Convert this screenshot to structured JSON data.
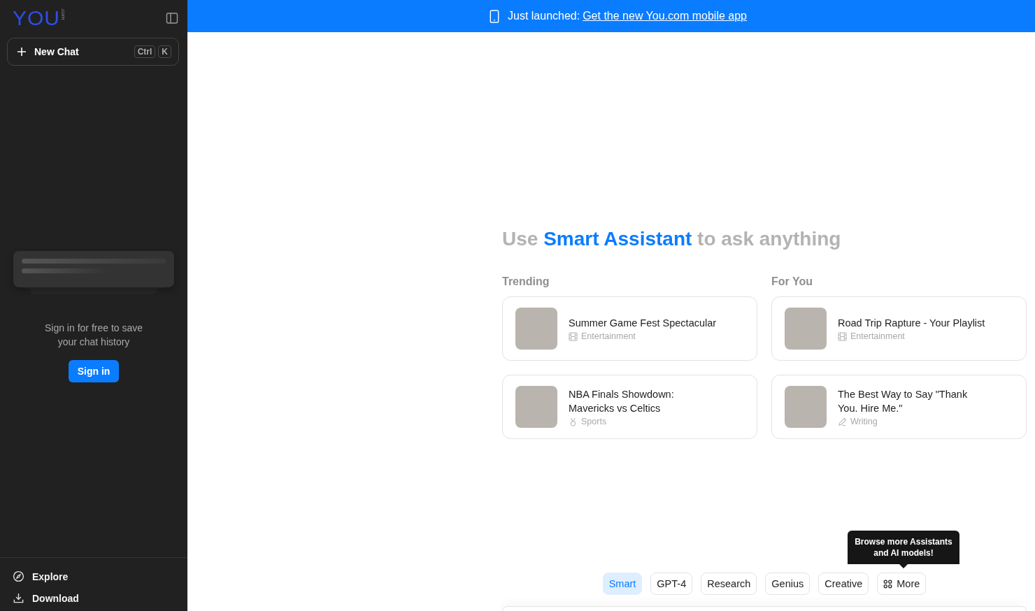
{
  "sidebar": {
    "logo": "YOU",
    "logo_suffix": ".com",
    "new_chat": {
      "label": "New Chat",
      "keys": [
        "Ctrl",
        "K"
      ]
    },
    "sign_in_prompt": "Sign in for free to save your chat history",
    "sign_in_button": "Sign in",
    "nav": [
      {
        "kind": "explore",
        "label": "Explore"
      },
      {
        "kind": "download",
        "label": "Download"
      }
    ]
  },
  "banner": {
    "text": "Just launched:",
    "link": "Get the new You.com mobile app"
  },
  "headline": {
    "prefix": "Use",
    "highlight": "Smart Assistant",
    "suffix": "to ask anything"
  },
  "sections": [
    {
      "title": "Trending",
      "cards": [
        {
          "title": "Summer Game Fest Spectacular",
          "category": "Entertainment",
          "kind": "film"
        },
        {
          "title": "NBA Finals Showdown: Mavericks vs Celtics",
          "category": "Sports",
          "kind": "medal"
        }
      ]
    },
    {
      "title": "For You",
      "cards": [
        {
          "title": "Road Trip Rapture - Your Playlist",
          "category": "Entertainment",
          "kind": "film"
        },
        {
          "title": "The Best Way to Say \"Thank You. Hire Me.\"",
          "category": "Writing",
          "kind": "pen"
        }
      ]
    }
  ],
  "tooltip": "Browse more Assistants and AI models!",
  "assistants": [
    {
      "label": "Smart",
      "kind": "text",
      "selected": true
    },
    {
      "label": "GPT-4",
      "kind": "text",
      "selected": false
    },
    {
      "label": "Research",
      "kind": "text",
      "selected": false
    },
    {
      "label": "Genius",
      "kind": "text",
      "selected": false
    },
    {
      "label": "Creative",
      "kind": "text",
      "selected": false
    },
    {
      "label": "More",
      "kind": "more",
      "selected": false
    }
  ]
}
